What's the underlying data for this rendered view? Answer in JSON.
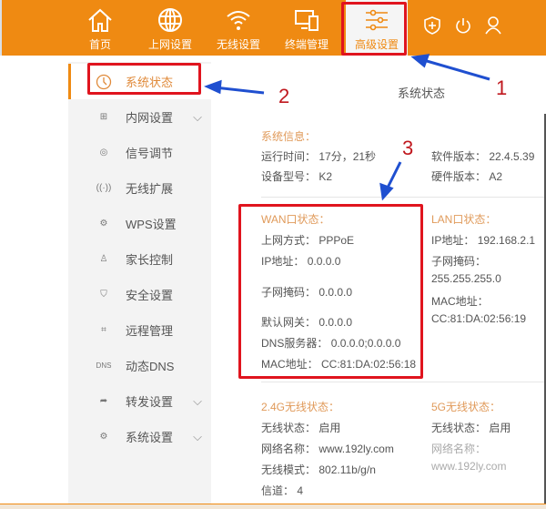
{
  "nav": {
    "items": [
      {
        "label": "首页",
        "icon": "home-icon"
      },
      {
        "label": "上网设置",
        "icon": "globe-icon"
      },
      {
        "label": "无线设置",
        "icon": "wifi-icon"
      },
      {
        "label": "终端管理",
        "icon": "devices-icon"
      },
      {
        "label": "高级设置",
        "icon": "sliders-icon"
      }
    ],
    "active": 4,
    "right_icons": [
      "shield-icon",
      "power-icon",
      "user-icon"
    ]
  },
  "sidebar": {
    "items": [
      {
        "label": "系统状态",
        "icon": "clock-icon"
      },
      {
        "label": "内网设置",
        "icon": "network-icon",
        "expandable": true
      },
      {
        "label": "信号调节",
        "icon": "signal-icon"
      },
      {
        "label": "无线扩展",
        "icon": "antenna-icon"
      },
      {
        "label": "WPS设置",
        "icon": "gear-w-icon"
      },
      {
        "label": "家长控制",
        "icon": "parental-icon"
      },
      {
        "label": "安全设置",
        "icon": "shield-icon"
      },
      {
        "label": "远程管理",
        "icon": "remote-icon"
      },
      {
        "label": "动态DNS",
        "icon": "dns-icon"
      },
      {
        "label": "转发设置",
        "icon": "forward-icon",
        "expandable": true
      },
      {
        "label": "系统设置",
        "icon": "gear-icon",
        "expandable": true
      }
    ]
  },
  "main": {
    "title": "系统状态",
    "sys": {
      "heading": "系统信息：",
      "uptime_label": "运行时间：",
      "uptime": "17分，21秒",
      "model_label": "设备型号：",
      "model": "K2",
      "sw_label": "软件版本：",
      "sw": "22.4.5.39",
      "hw_label": "硬件版本：",
      "hw": "A2"
    },
    "wan": {
      "heading": "WAN口状态：",
      "rows": [
        [
          "上网方式：",
          "PPPoE"
        ],
        [
          "IP地址：",
          "0.0.0.0"
        ],
        [
          "子网掩码：",
          "0.0.0.0"
        ],
        [
          "默认网关：",
          "0.0.0.0"
        ],
        [
          "DNS服务器：",
          "0.0.0.0;0.0.0.0"
        ],
        [
          "MAC地址：",
          "CC:81:DA:02:56:18"
        ]
      ]
    },
    "lan": {
      "heading": "LAN口状态：",
      "ip_label": "IP地址：",
      "ip": "192.168.2.1",
      "mask_label": "子网掩码：",
      "mask": "255.255.255.0",
      "mac_label": "MAC地址：",
      "mac": "CC:81:DA:02:56:19"
    },
    "w24": {
      "heading": "2.4G无线状态：",
      "rows": [
        [
          "无线状态：",
          "启用"
        ],
        [
          "网络名称：",
          "www.192ly.com"
        ],
        [
          "无线模式：",
          "802.11b/g/n"
        ],
        [
          "信道：",
          "4"
        ]
      ]
    },
    "w5": {
      "heading": "5G无线状态：",
      "rows": [
        [
          "无线状态：",
          "启用"
        ],
        [
          "网络名称：",
          "www.192ly.com"
        ]
      ]
    }
  },
  "annotations": [
    "1",
    "2",
    "3"
  ],
  "colors": {
    "brand": "#ef8a12",
    "highlight": "#e0141e",
    "arrow": "#1f4fd0"
  }
}
